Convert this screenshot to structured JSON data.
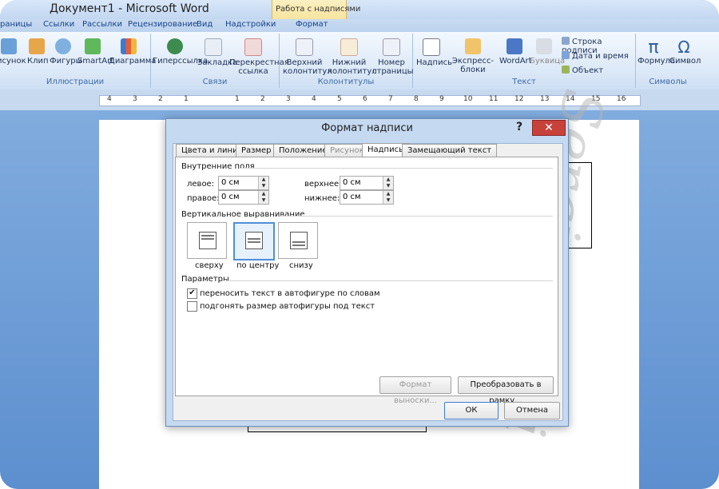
{
  "window": {
    "title": "Документ1 - Microsoft Word",
    "context_tab_group": "Работа с надписями"
  },
  "tabs": [
    "раницы",
    "Ссылки",
    "Рассылки",
    "Рецензирование",
    "Вид",
    "Надстройки",
    "Формат"
  ],
  "ribbon": {
    "illustrations": {
      "label": "Иллюстрации",
      "buttons": [
        "исунок",
        "Клип",
        "Фигуры",
        "SmartArt",
        "Диаграмма"
      ]
    },
    "links": {
      "label": "Связи",
      "buttons": [
        "Гиперссылка",
        "Закладка",
        "Перекрестная",
        "ссылка"
      ]
    },
    "headers": {
      "label": "Колонтитулы",
      "buttons": [
        "Верхний",
        "колонтитул",
        "Нижний",
        "колонтитул",
        "Номер",
        "страницы"
      ]
    },
    "text": {
      "label": "Текст",
      "buttons": [
        "Надпись",
        "Экспресс-блоки",
        "WordArt",
        "Буквица"
      ],
      "small": [
        "Строка подписи",
        "Дата и время",
        "Объект"
      ]
    },
    "symbols": {
      "label": "Символы",
      "buttons": [
        "Формула",
        "Символ"
      ],
      "glyphs": [
        "π",
        "Ω"
      ]
    }
  },
  "ruler": {
    "numbers": [
      "4",
      "3",
      "2",
      "1",
      "1",
      "2",
      "3",
      "4",
      "5",
      "6",
      "7",
      "8",
      "9",
      "10",
      "11",
      "12",
      "13",
      "14",
      "15",
      "16"
    ]
  },
  "dialog": {
    "title": "Формат надписи",
    "help": "?",
    "close": "✕",
    "tabs": [
      "Цвета и линии",
      "Размер",
      "Положение",
      "Рисунок",
      "Надпись",
      "Замещающий текст"
    ],
    "inner_margins": {
      "label": "Внутренние поля",
      "left_label": "левое:",
      "left_value": "0 см",
      "right_label": "правое:",
      "right_value": "0 см",
      "top_label": "верхнее:",
      "top_value": "0 см",
      "bottom_label": "нижнее:",
      "bottom_value": "0 см"
    },
    "vertical_alignment": {
      "label": "Вертикальное выравнивание",
      "options": [
        "сверху",
        "по центру",
        "снизу"
      ],
      "selected": "по центру"
    },
    "params": {
      "label": "Параметры",
      "wrap_text": "переносить текст в автофигуре по словам",
      "resize_shape": "подгонять размер автофигуры под текст"
    },
    "buttons": {
      "callout": "Формат выноски...",
      "convert": "Преобразовать в рамку...",
      "ok": "ОК",
      "cancel": "Отмена"
    }
  },
  "colors": {
    "accent": "#4f8fd8",
    "close": "#c7423a"
  }
}
